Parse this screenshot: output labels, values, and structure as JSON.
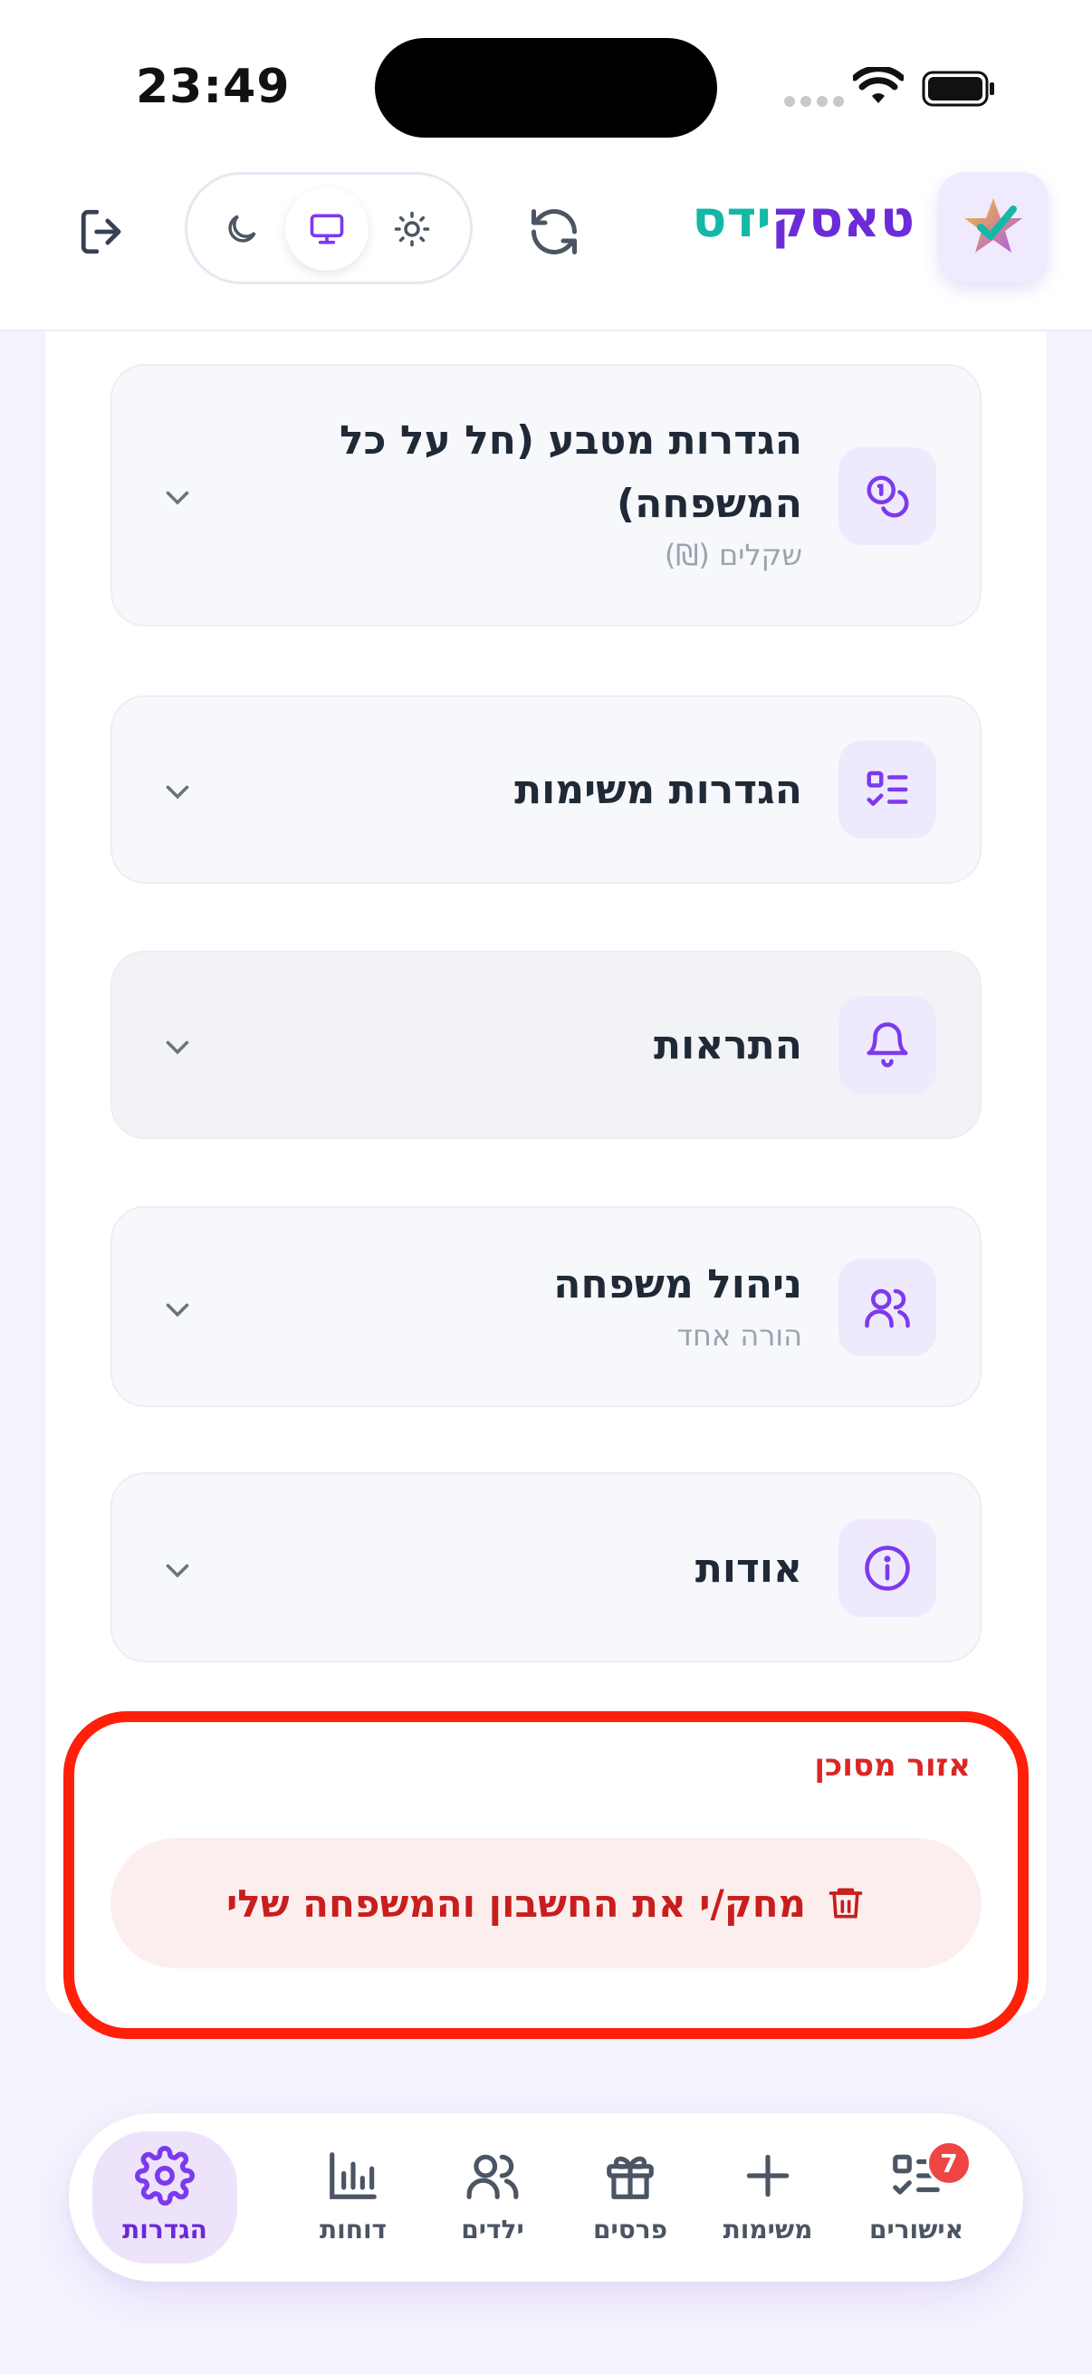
{
  "status_bar": {
    "time": "23:49"
  },
  "header": {
    "brand_part_1": "טאסק",
    "brand_part_2": "ידס",
    "theme_options": [
      "dark",
      "system",
      "light"
    ],
    "active_theme": "system"
  },
  "sections": [
    {
      "title": "הגדרות מטבע (חל על כל המשפחה)",
      "subtitle": "שקלים (₪)",
      "icon": "coins-icon"
    },
    {
      "title": "הגדרות משימות",
      "subtitle": "",
      "icon": "list-checks-icon"
    },
    {
      "title": "התראות",
      "subtitle": "",
      "icon": "bell-icon"
    },
    {
      "title": "ניהול משפחה",
      "subtitle": "הורה אחד",
      "icon": "users-icon"
    },
    {
      "title": "אודות",
      "subtitle": "",
      "icon": "info-icon"
    }
  ],
  "danger_zone": {
    "label": "אזור מסוכן",
    "delete_button": "מחק/י את החשבון והמשפחה שלי",
    "accent_color": "#dc2626"
  },
  "bottom_nav": {
    "items": [
      {
        "label": "אישורים",
        "icon": "approvals-icon",
        "badge": "7"
      },
      {
        "label": "משימות",
        "icon": "plus-icon"
      },
      {
        "label": "פרסים",
        "icon": "gift-icon"
      },
      {
        "label": "ילדים",
        "icon": "users-icon"
      },
      {
        "label": "דוחות",
        "icon": "bar-chart-icon"
      },
      {
        "label": "הגדרות",
        "icon": "gear-icon"
      }
    ],
    "active": "הגדרות"
  },
  "colors": {
    "brand_purple": "#6c2bd9",
    "brand_teal": "#14b8a6",
    "danger_red": "#dc2626"
  }
}
